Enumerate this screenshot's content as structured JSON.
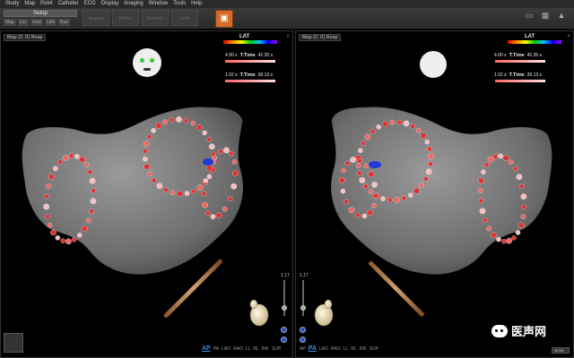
{
  "menu": [
    "Study",
    "Map",
    "Point",
    "Catheter",
    "ECG",
    "Display",
    "Imaging",
    "Window",
    "Tools",
    "Help"
  ],
  "toolbar": {
    "setup_label": "Setup",
    "tool_buttons": [
      "Map",
      "Loc",
      "Verif",
      "Lbls",
      "Run"
    ],
    "ghost_buttons": [
      "Acquire",
      "Delete",
      "Refresh",
      "Undo"
    ]
  },
  "left_view": {
    "header": "Map (2, 0) Resp",
    "lat_label": "LAT",
    "ttime_rows": [
      {
        "left_value": "4.00 s",
        "label": "T.Time",
        "right_value": "42.35 s"
      },
      {
        "left_value": "1.02 s",
        "label": "T.Time",
        "right_value": "39.13 s"
      }
    ],
    "slider_value": "1.17",
    "views": [
      "AP",
      "PA",
      "LAO",
      "RAO",
      "LL",
      "RL",
      "INF",
      "SUP"
    ],
    "active_view": "AP"
  },
  "right_view": {
    "header": "Map (2, 0) Resp",
    "lat_label": "LAT",
    "ttime_rows": [
      {
        "left_value": "4.00 s",
        "label": "T.Time",
        "right_value": "42.35 s"
      },
      {
        "left_value": "1.02 s",
        "label": "T.Time",
        "right_value": "39.13 s"
      }
    ],
    "slider_value": "1.17",
    "views": [
      "AP",
      "PA",
      "LAO",
      "RAO",
      "LL",
      "RL",
      "INF",
      "SUP"
    ],
    "active_view": "PA"
  },
  "dropdown_label": "None",
  "watermark_text": "医声网",
  "colors": {
    "accent": "#3a8ce0",
    "point_red": "#d33",
    "point_pink": "#f0b0b0",
    "mesh": "#7a7a7a",
    "ablation_blue": "#1e3ad8"
  }
}
